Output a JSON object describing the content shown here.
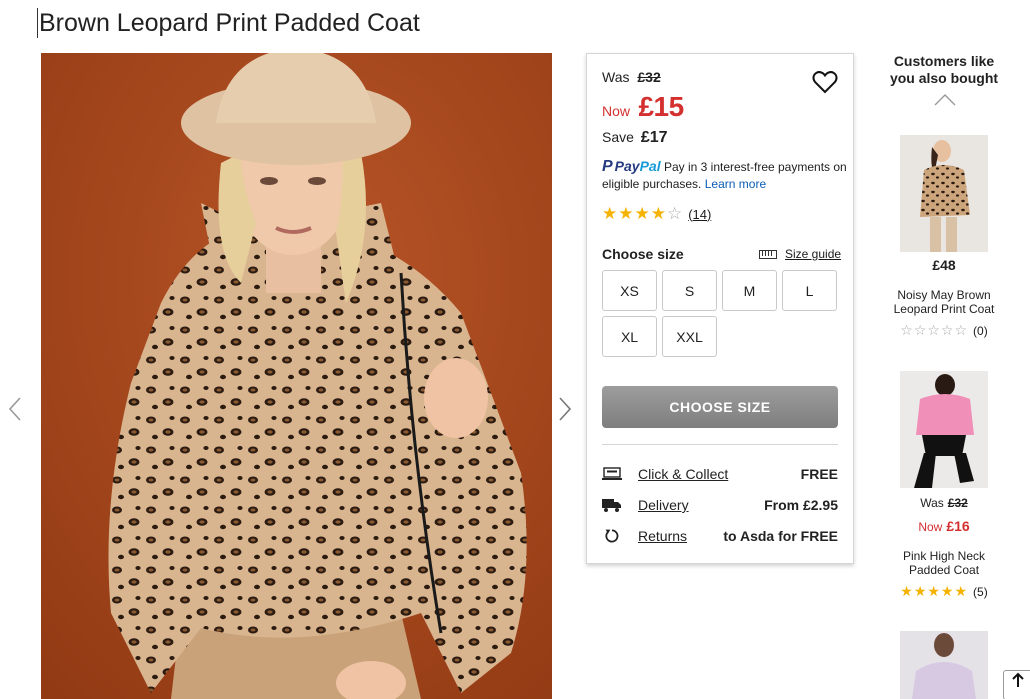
{
  "product": {
    "title": "Brown Leopard Print Padded Coat"
  },
  "pricing": {
    "was_label": "Was",
    "was_price": "£32",
    "now_label": "Now",
    "now_price": "£15",
    "save_label": "Save",
    "save_amount": "£17"
  },
  "paypal": {
    "logo_pay": "Pay",
    "logo_pal": "Pal",
    "text": "Pay in 3 interest-free payments on eligible purchases.",
    "learn_more": "Learn more"
  },
  "rating": {
    "stars": 4,
    "max": 5,
    "count": "(14)"
  },
  "size_selector": {
    "label": "Choose size",
    "guide_label": "Size guide",
    "sizes": [
      "XS",
      "S",
      "M",
      "L",
      "XL",
      "XXL"
    ],
    "button_label": "CHOOSE SIZE"
  },
  "delivery": [
    {
      "icon": "click-collect-icon",
      "label": "Click & Collect",
      "value": "FREE"
    },
    {
      "icon": "truck-icon",
      "label": "Delivery",
      "value": "From £2.95"
    },
    {
      "icon": "returns-icon",
      "label": "Returns",
      "value": "to Asda for FREE"
    }
  ],
  "recommendations": {
    "title": "Customers like you also bought",
    "items": [
      {
        "price": "£48",
        "name": "Noisy May Brown Leopard Print Coat",
        "stars": 0,
        "count": "(0)"
      },
      {
        "was_label": "Was",
        "was_price": "£32",
        "now_label": "Now",
        "now_price": "£16",
        "name": "Pink High Neck Padded Coat",
        "stars": 5,
        "count": "(5)"
      }
    ]
  },
  "colors": {
    "sale_red": "#d3302f",
    "star_yellow": "#f5b301",
    "link_blue": "#0c5cb5",
    "button_grey": "#8a8a8a",
    "hero_background": "#a8471e"
  }
}
